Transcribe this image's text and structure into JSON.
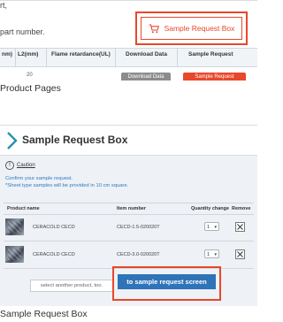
{
  "product_page": {
    "intro_line1": "rt,",
    "intro_line2": "part number.",
    "sample_request_box_button": "Sample Request Box",
    "table_headers": [
      "nm)",
      "L2(mm)",
      "Flame retardance(UL)",
      "Download Data",
      "Sample Request"
    ],
    "row_value": "20",
    "download_button": "Download Data",
    "sample_request_button": "Sample Request"
  },
  "captions": {
    "product_pages": "Product Pages",
    "sample_request_box": "Sample Request Box"
  },
  "sample_request_box": {
    "title": "Sample Request Box",
    "caution": "Caution",
    "confirm_line1": "Confirm your sample request.",
    "confirm_line2": "*Sheet type samples will be provided in 10 cm square.",
    "list_headers": {
      "product_name": "Product name",
      "item_number": "Item number",
      "quantity_change": "Quantity change",
      "remove": "Remove"
    },
    "items": [
      {
        "name": "CERACOLD CECD",
        "item_number": "CECD-1.5-020020T",
        "quantity": "1"
      },
      {
        "name": "CERACOLD CECD",
        "item_number": "CECD-3.0-020020T",
        "quantity": "1"
      }
    ],
    "select_another_button": "select another product, too.",
    "to_request_screen_button": "to sample request screen"
  },
  "colors": {
    "accent_orange": "#e8472b",
    "primary_blue": "#2f73b8",
    "chevron_teal": "#2a8fb5"
  }
}
